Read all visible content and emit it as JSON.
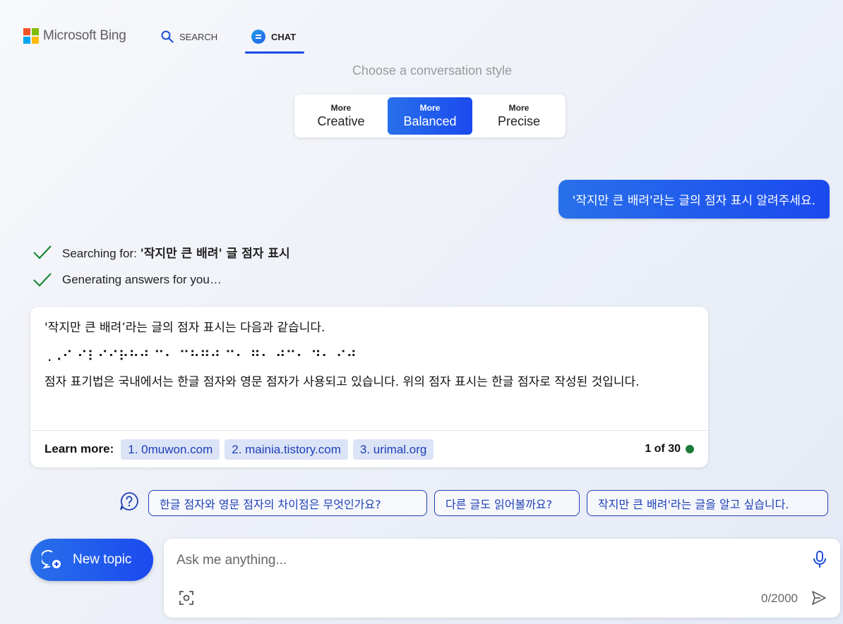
{
  "header": {
    "logo_text": "Microsoft Bing",
    "tabs": [
      {
        "label": "SEARCH",
        "icon": "search-icon"
      },
      {
        "label": "CHAT",
        "icon": "chat-icon",
        "active": true
      }
    ]
  },
  "style_chooser": {
    "title": "Choose a conversation style",
    "options": [
      {
        "small": "More",
        "big": "Creative"
      },
      {
        "small": "More",
        "big": "Balanced",
        "active": true
      },
      {
        "small": "More",
        "big": "Precise"
      }
    ]
  },
  "user_message": "'작지만 큰 배려'라는 글의 점자 표시 알려주세요.",
  "status": {
    "searching_prefix": "Searching for: ",
    "searching_query": "'작지만 큰 배려' 글 점자 표시",
    "generating": "Generating answers for you…"
  },
  "answer": {
    "intro": "'작지만 큰 배려’라는 글의 점자 표시는 다음과 같습니다.",
    "braille": ".⠠⠊ ⠊⠇⠊⠊⠗⠓⠚ ⠉⠂ ⠉⠓⠛⠚ ⠉⠂ ⠛⠂ ⠚⠉⠂ ⠙⠂ ⠊⠚",
    "body": "점자 표기법은 국내에서는 한글 점자와 영문 점자가 사용되고 있습니다. 위의 점자 표시는 한글 점자로 작성된 것입니다.",
    "learn_more_label": "Learn more:",
    "citations": [
      "1. 0muwon.com",
      "2. mainia.tistory.com",
      "3. urimal.org"
    ],
    "count": "1 of 30"
  },
  "suggestions": [
    "한글 점자와 영문 점자의 차이점은 무엇인가요?",
    "다른 글도 읽어볼까요?",
    "작지만 큰 배려'라는 글을 알고 싶습니다."
  ],
  "composer": {
    "new_topic_label": "New topic",
    "placeholder": "Ask me anything...",
    "char_counter": "0/2000"
  },
  "colors": {
    "accent": "#1b4aef",
    "check": "#1c8a3a",
    "citation_bg": "#dbe3f7"
  }
}
